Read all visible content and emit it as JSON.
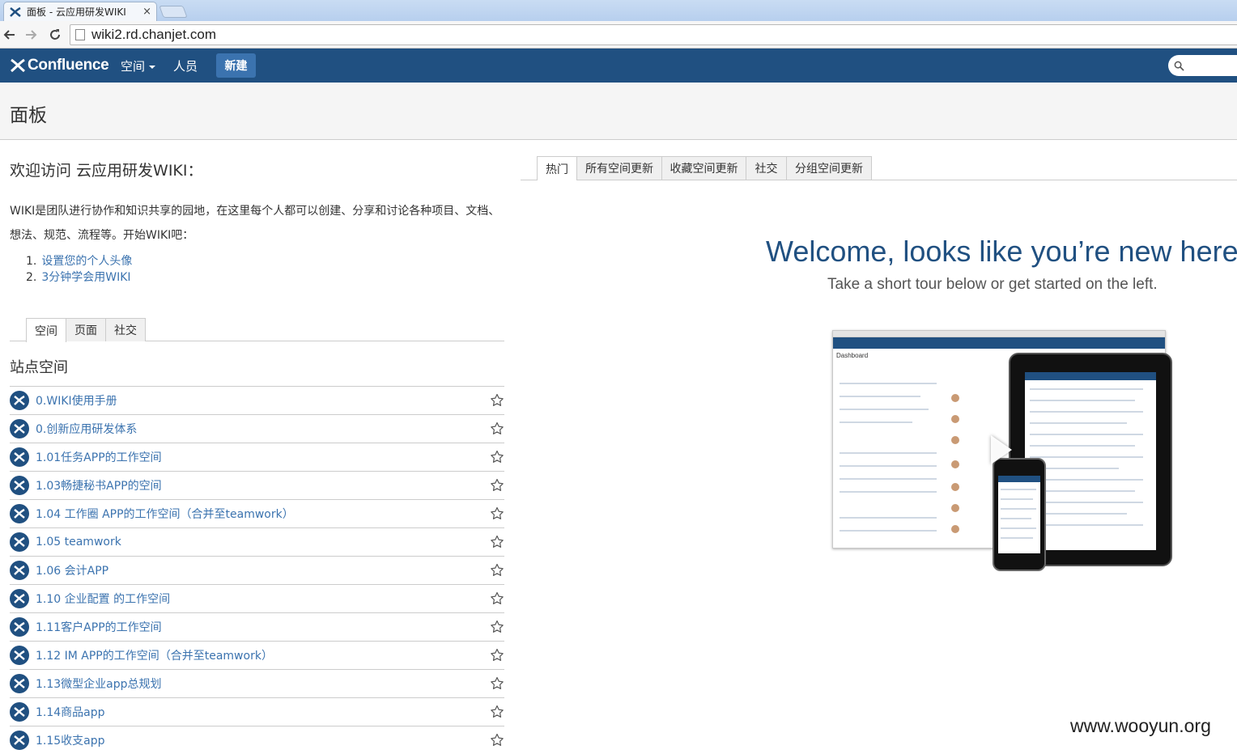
{
  "browser": {
    "tab_title": "面板 - 云应用研发WIKI",
    "tab_close": "×",
    "url": "wiki2.rd.chanjet.com"
  },
  "header": {
    "logo_text": "Confluence",
    "nav_spaces": "空间",
    "nav_people": "人员",
    "create_label": "新建",
    "brand_color": "#205081"
  },
  "page": {
    "title": "面板"
  },
  "welcome": {
    "heading": "欢迎访问 云应用研发WIKI：",
    "intro_line1": "WIKI是团队进行协作和知识共享的园地，在这里每个人都可以创建、分享和讨论各种项目、文档、",
    "intro_line2": "想法、规范、流程等。开始WIKI吧：",
    "steps": [
      {
        "num": "1.",
        "label": "设置您的个人头像"
      },
      {
        "num": "2.",
        "label": "3分钟学会用WIKI"
      }
    ]
  },
  "left_tabs": [
    "空间",
    "页面",
    "社交"
  ],
  "site_spaces": {
    "title": "站点空间",
    "items": [
      "0.WIKI使用手册",
      "0.创新应用研发体系",
      "1.01任务APP的工作空间",
      "1.03畅捷秘书APP的空间",
      "1.04 工作圈 APP的工作空间（合并至teamwork）",
      "1.05 teamwork",
      "1.06 会计APP",
      "1.10 企业配置 的工作空间",
      "1.11客户APP的工作空间",
      "1.12 IM APP的工作空间（合并至teamwork）",
      "1.13微型企业app总规划",
      "1.14商品app",
      "1.15收支app"
    ]
  },
  "right_tabs": [
    "热门",
    "所有空间更新",
    "收藏空间更新",
    "社交",
    "分组空间更新"
  ],
  "tour": {
    "heading": "Welcome, looks like you’re new here",
    "subheading": "Take a short tour below or get started on the left.",
    "preview_title": "Dashboard"
  },
  "watermark": "www.wooyun.org"
}
